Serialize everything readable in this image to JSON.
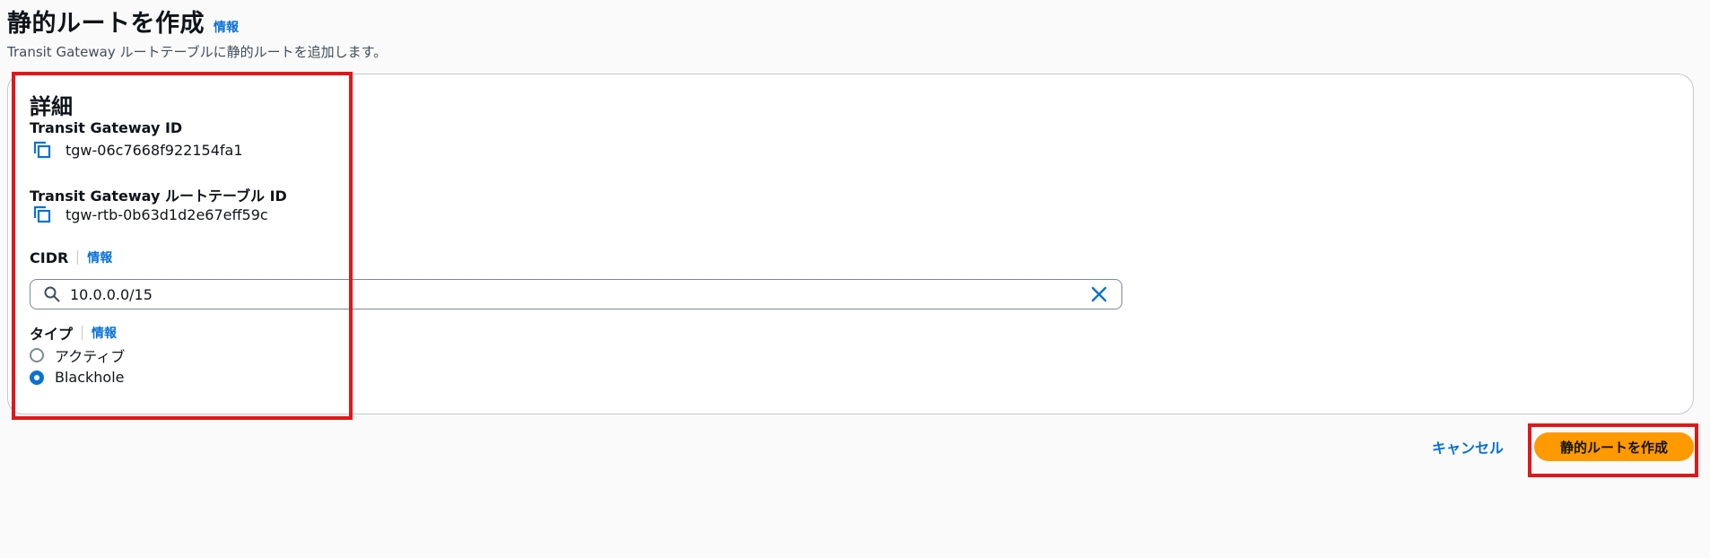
{
  "header": {
    "title": "静的ルートを作成",
    "info": "情報",
    "description": "Transit Gateway ルートテーブルに静的ルートを追加します。"
  },
  "details": {
    "section_title": "詳細",
    "tgw_id_label": "Transit Gateway ID",
    "tgw_id_value": "tgw-06c7668f922154fa1",
    "rtb_id_label": "Transit Gateway ルートテーブル ID",
    "rtb_id_value": "tgw-rtb-0b63d1d2e67eff59c",
    "cidr_label": "CIDR",
    "cidr_info": "情報",
    "cidr_value": "10.0.0.0/15",
    "type_label": "タイプ",
    "type_info": "情報",
    "type_options": [
      {
        "label": "アクティブ",
        "selected": false
      },
      {
        "label": "Blackhole",
        "selected": true
      }
    ]
  },
  "actions": {
    "cancel": "キャンセル",
    "create": "静的ルートを作成"
  },
  "colors": {
    "link": "#0972d3",
    "primary": "#ff9900",
    "highlight": "#e0181b"
  }
}
